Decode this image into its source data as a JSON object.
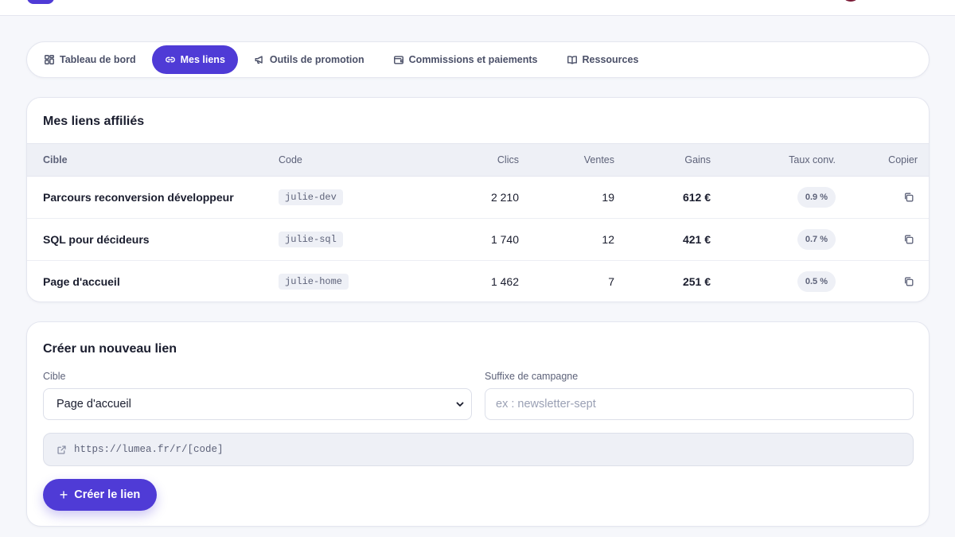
{
  "colors": {
    "accent": "#4f3bd6",
    "background": "#f6f7fb",
    "text": "#1a1d2e",
    "muted": "#5d6279"
  },
  "tabs": [
    {
      "label": "Tableau de bord",
      "icon": "dashboard-grid-icon",
      "active": false
    },
    {
      "label": "Mes liens",
      "icon": "link-icon",
      "active": true
    },
    {
      "label": "Outils de promotion",
      "icon": "megaphone-icon",
      "active": false
    },
    {
      "label": "Commissions et paiements",
      "icon": "wallet-icon",
      "active": false
    },
    {
      "label": "Ressources",
      "icon": "book-icon",
      "active": false
    }
  ],
  "links_card": {
    "title": "Mes liens affiliés",
    "columns": {
      "target": "Cible",
      "code": "Code",
      "clicks": "Clics",
      "sales": "Ventes",
      "gains": "Gains",
      "conv": "Taux conv.",
      "copy": "Copier"
    },
    "rows": [
      {
        "target": "Parcours reconversion développeur",
        "code": "julie-dev",
        "clicks": "2 210",
        "sales": "19",
        "gains": "612 €",
        "conv": "0.9 %"
      },
      {
        "target": "SQL pour décideurs",
        "code": "julie-sql",
        "clicks": "1 740",
        "sales": "12",
        "gains": "421 €",
        "conv": "0.7 %"
      },
      {
        "target": "Page d'accueil",
        "code": "julie-home",
        "clicks": "1 462",
        "sales": "7",
        "gains": "251 €",
        "conv": "0.5 %"
      }
    ]
  },
  "create_card": {
    "title": "Créer un nouveau lien",
    "target_label": "Cible",
    "target_value": "Page d'accueil",
    "suffix_label": "Suffixe de campagne",
    "suffix_value": "",
    "suffix_placeholder": "ex : newsletter-sept",
    "preview_url": "https://lumea.fr/r/[code]",
    "button_label": "Créer le lien"
  }
}
